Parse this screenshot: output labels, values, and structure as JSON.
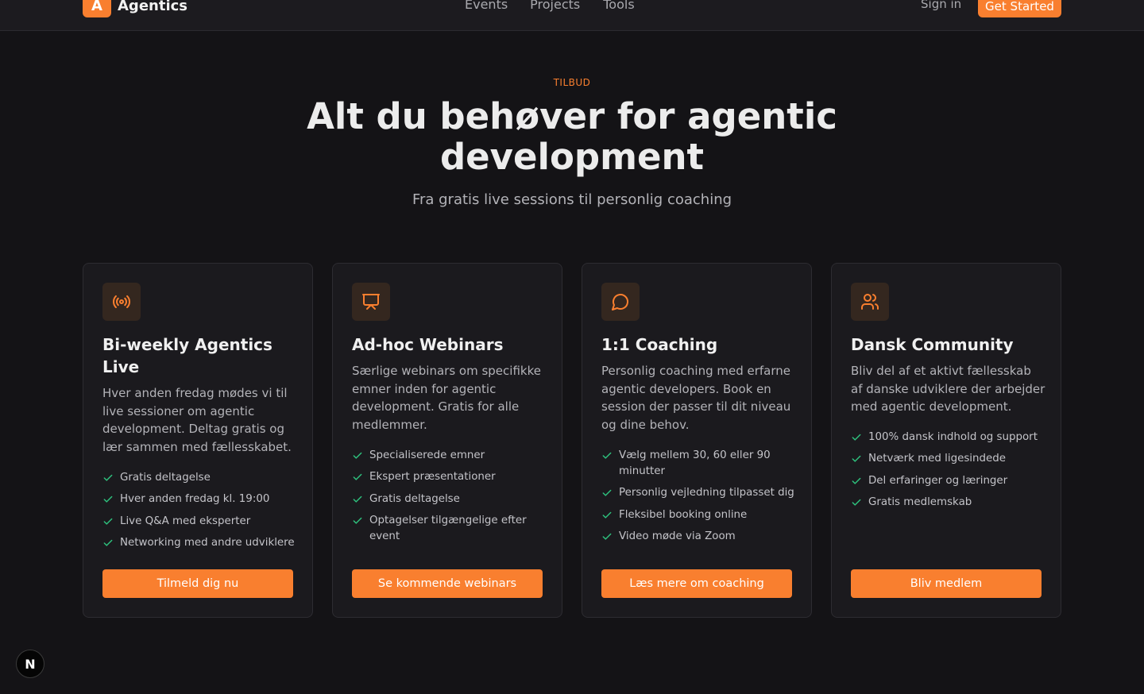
{
  "header": {
    "logo_letter": "A",
    "brand": "Agentics",
    "nav": [
      "Events",
      "Projects",
      "Tools"
    ],
    "sign_in": "Sign in",
    "get_started": "Get Started"
  },
  "hero": {
    "eyebrow": "TILBUD",
    "title": "Alt du behøver for agentic development",
    "subtitle": "Fra gratis live sessions til personlig coaching"
  },
  "colors": {
    "accent": "#f97f2f",
    "check": "#2ec27e",
    "background": "#141316",
    "card": "#1b1a1e"
  },
  "cards": [
    {
      "icon": "broadcast-icon",
      "title": "Bi-weekly Agentics Live",
      "description": "Hver anden fredag mødes vi til live sessioner om agentic development. Deltag gratis og lær sammen med fællesskabet.",
      "features": [
        "Gratis deltagelse",
        "Hver anden fredag kl. 19:00",
        "Live Q&A med eksperter",
        "Networking med andre udviklere"
      ],
      "cta": "Tilmeld dig nu"
    },
    {
      "icon": "presentation-icon",
      "title": "Ad-hoc Webinars",
      "description": "Særlige webinars om specifikke emner inden for agentic development. Gratis for alle medlemmer.",
      "features": [
        "Specialiserede emner",
        "Ekspert præsentationer",
        "Gratis deltagelse",
        "Optagelser tilgængelige efter event"
      ],
      "cta": "Se kommende webinars"
    },
    {
      "icon": "chat-bubble-icon",
      "title": "1:1 Coaching",
      "description": "Personlig coaching med erfarne agentic developers. Book en session der passer til dit niveau og dine behov.",
      "features": [
        "Vælg mellem 30, 60 eller 90 minutter",
        "Personlig vejledning tilpasset dig",
        "Fleksibel booking online",
        "Video møde via Zoom"
      ],
      "cta": "Læs mere om coaching"
    },
    {
      "icon": "users-icon",
      "title": "Dansk Community",
      "description": "Bliv del af et aktivt fællesskab af danske udviklere der arbejder med agentic development.",
      "features": [
        "100% dansk indhold og support",
        "Netværk med ligesindede",
        "Del erfaringer og læringer",
        "Gratis medlemskab"
      ],
      "cta": "Bliv medlem"
    }
  ],
  "dev_badge": "N"
}
